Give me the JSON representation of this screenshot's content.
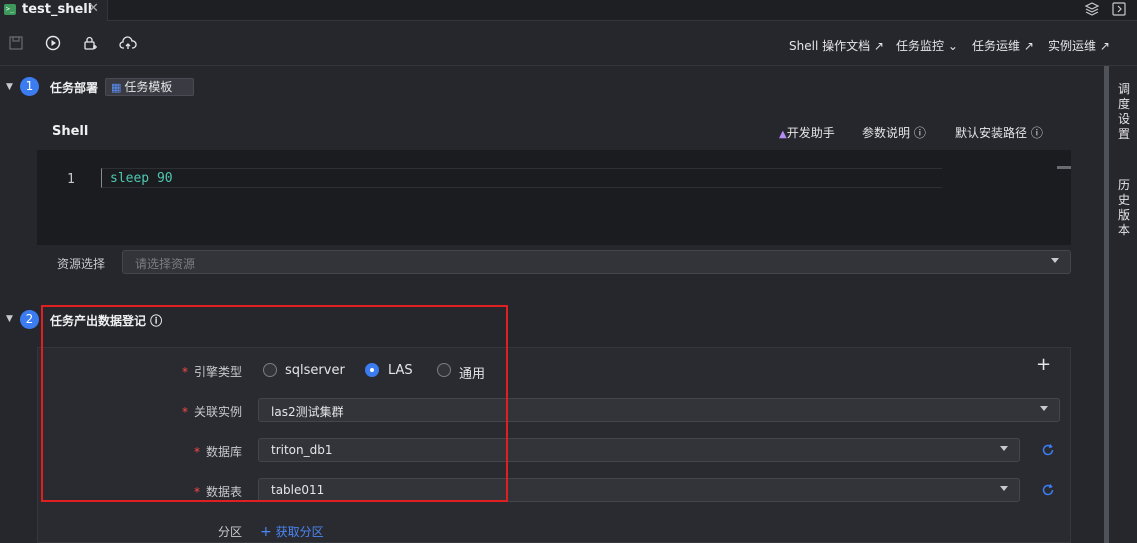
{
  "tab": {
    "title": "test_shell",
    "icon_text": ">_"
  },
  "toolbar": {
    "links": [
      "Shell 操作文档 ↗",
      "任务监控 ⌄",
      "任务运维 ↗",
      "实例运维 ↗"
    ]
  },
  "side_tabs": [
    "调度设置",
    "历史版本"
  ],
  "section1": {
    "number": "1",
    "title": "任务部署",
    "template_button": "任务模板",
    "editor_title": "Shell",
    "actions": [
      "开发助手",
      "参数说明 ⓘ",
      "默认安装路径 ⓘ"
    ],
    "code": {
      "line_number": "1",
      "text": "sleep 90"
    },
    "resource": {
      "label": "资源选择",
      "placeholder": "请选择资源"
    }
  },
  "section2": {
    "number": "2",
    "title": "任务产出数据登记 ⓘ",
    "engine": {
      "label": "引擎类型",
      "options": [
        "sqlserver",
        "LAS",
        "通用"
      ],
      "selected": "LAS"
    },
    "instance": {
      "label": "关联实例",
      "value": "las2测试集群"
    },
    "database": {
      "label": "数据库",
      "value": "triton_db1"
    },
    "table": {
      "label": "数据表",
      "value": "table011"
    },
    "partition": {
      "label": "分区",
      "action": "获取分区"
    },
    "required_mark": "*",
    "add_symbol": "+"
  },
  "colors": {
    "accent": "#3b7cf0",
    "highlight_box": "#e02020",
    "required": "#f54a45"
  }
}
